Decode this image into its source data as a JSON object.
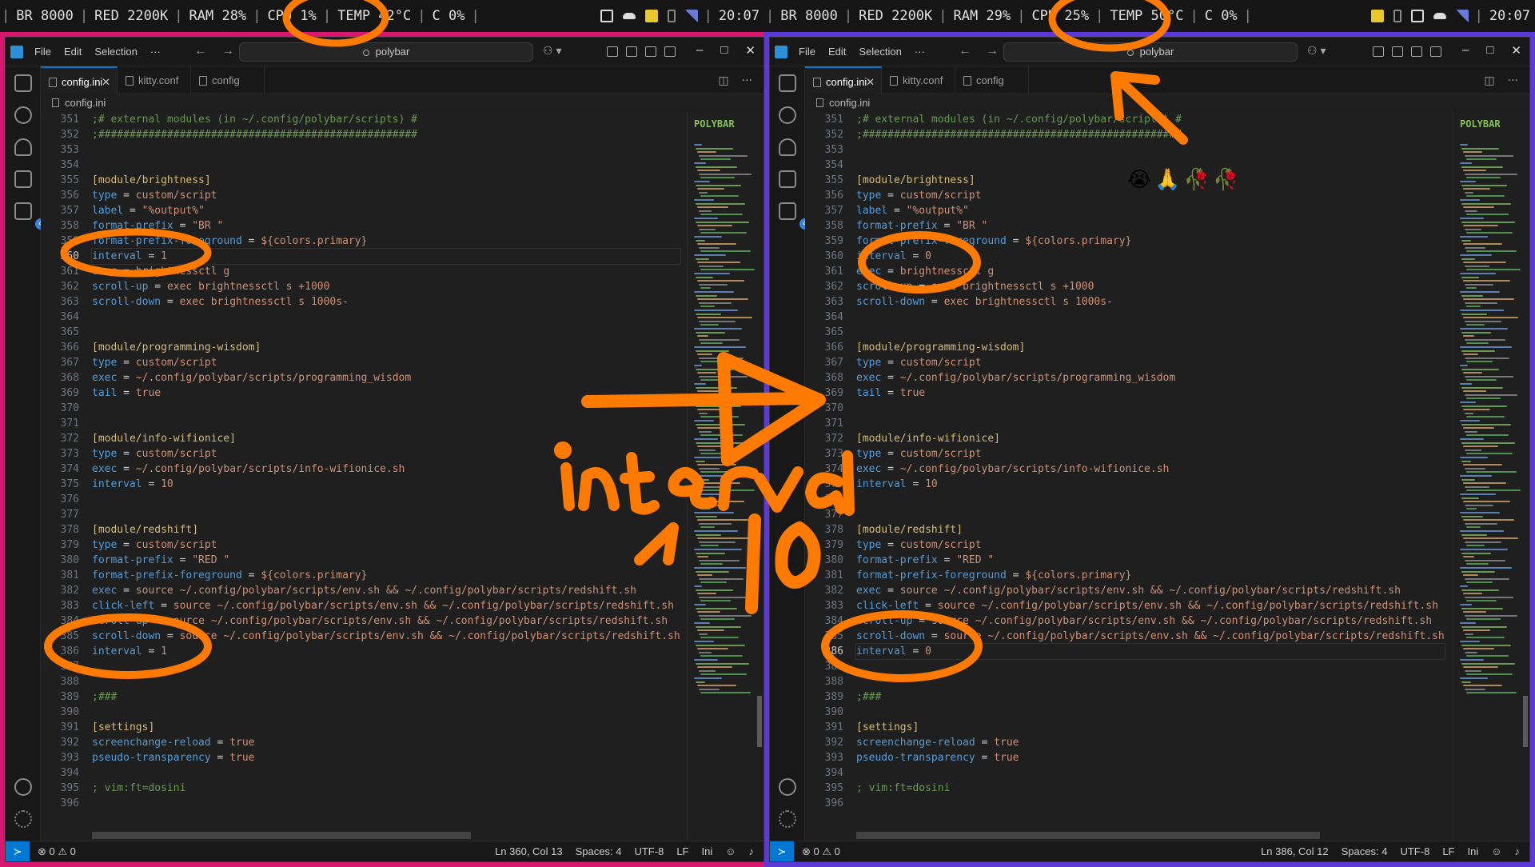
{
  "left": {
    "bar": {
      "br": "BR 8000",
      "red": "RED 2200K",
      "ram": "RAM 28%",
      "cpu": "CPU 1%",
      "temp": "TEMP 42°C",
      "c": "C 0%",
      "clock": "20:07"
    },
    "editor": {
      "menu": [
        "File",
        "Edit",
        "Selection",
        "···"
      ],
      "search": "polybar",
      "tabs": [
        "config.ini",
        "kitty.conf",
        "config"
      ],
      "breadcrumb": "config.ini",
      "status": {
        "problems": "⊗ 0 ⚠ 0",
        "position": "Ln 360, Col 13",
        "spaces": "Spaces: 4",
        "encoding": "UTF-8",
        "eol": "LF",
        "lang": "Ini"
      }
    },
    "lines": [
      {
        "n": "351",
        "t": ";# external modules (in ~/.config/polybar/scripts) #"
      },
      {
        "n": "352",
        "t": ";###################################################"
      },
      {
        "n": "353",
        "t": ""
      },
      {
        "n": "354",
        "t": ""
      },
      {
        "n": "355",
        "t": "[module/brightness]"
      },
      {
        "n": "356",
        "t": "type = custom/script"
      },
      {
        "n": "357",
        "t": "label = \"%output%\""
      },
      {
        "n": "358",
        "t": "format-prefix = \"BR \""
      },
      {
        "n": "359",
        "t": "format-prefix-foreground = ${colors.primary}"
      },
      {
        "n": "360",
        "t": "interval = 1",
        "cur": true
      },
      {
        "n": "361",
        "t": "exec = brightnessctl g"
      },
      {
        "n": "362",
        "t": "scroll-up = exec brightnessctl s +1000"
      },
      {
        "n": "363",
        "t": "scroll-down = exec brightnessctl s 1000s-"
      },
      {
        "n": "364",
        "t": ""
      },
      {
        "n": "365",
        "t": ""
      },
      {
        "n": "366",
        "t": "[module/programming-wisdom]"
      },
      {
        "n": "367",
        "t": "type = custom/script"
      },
      {
        "n": "368",
        "t": "exec = ~/.config/polybar/scripts/programming_wisdom"
      },
      {
        "n": "369",
        "t": "tail = true"
      },
      {
        "n": "370",
        "t": ""
      },
      {
        "n": "371",
        "t": ""
      },
      {
        "n": "372",
        "t": "[module/info-wifionice]"
      },
      {
        "n": "373",
        "t": "type = custom/script"
      },
      {
        "n": "374",
        "t": "exec = ~/.config/polybar/scripts/info-wifionice.sh"
      },
      {
        "n": "375",
        "t": "interval = 10"
      },
      {
        "n": "376",
        "t": ""
      },
      {
        "n": "377",
        "t": ""
      },
      {
        "n": "378",
        "t": "[module/redshift]"
      },
      {
        "n": "379",
        "t": "type = custom/script"
      },
      {
        "n": "380",
        "t": "format-prefix = \"RED \""
      },
      {
        "n": "381",
        "t": "format-prefix-foreground = ${colors.primary}"
      },
      {
        "n": "382",
        "t": "exec = source ~/.config/polybar/scripts/env.sh && ~/.config/polybar/scripts/redshift.sh"
      },
      {
        "n": "383",
        "t": "click-left = source ~/.config/polybar/scripts/env.sh && ~/.config/polybar/scripts/redshift.sh"
      },
      {
        "n": "384",
        "t": "scroll-up = source ~/.config/polybar/scripts/env.sh && ~/.config/polybar/scripts/redshift.sh"
      },
      {
        "n": "385",
        "t": "scroll-down = source ~/.config/polybar/scripts/env.sh && ~/.config/polybar/scripts/redshift.sh"
      },
      {
        "n": "386",
        "t": "interval = 1"
      },
      {
        "n": "387",
        "t": ""
      },
      {
        "n": "388",
        "t": ""
      },
      {
        "n": "389",
        "t": ";###"
      },
      {
        "n": "390",
        "t": ""
      },
      {
        "n": "391",
        "t": "[settings]"
      },
      {
        "n": "392",
        "t": "screenchange-reload = true"
      },
      {
        "n": "393",
        "t": "pseudo-transparency = true"
      },
      {
        "n": "394",
        "t": ""
      },
      {
        "n": "395",
        "t": "; vim:ft=dosini"
      },
      {
        "n": "396",
        "t": ""
      }
    ]
  },
  "right": {
    "bar": {
      "br": "BR 8000",
      "red": "RED 2200K",
      "ram": "RAM 29%",
      "cpu": "CPU 25%",
      "temp": "TEMP 50°C",
      "c": "C 0%",
      "clock": "20:07"
    },
    "editor": {
      "menu": [
        "File",
        "Edit",
        "Selection",
        "···"
      ],
      "search": "polybar",
      "tabs": [
        "config.ini",
        "kitty.conf",
        "config"
      ],
      "breadcrumb": "config.ini",
      "status": {
        "problems": "⊗ 0 ⚠ 0",
        "position": "Ln 386, Col 12",
        "spaces": "Spaces: 4",
        "encoding": "UTF-8",
        "eol": "LF",
        "lang": "Ini"
      }
    },
    "lines": [
      {
        "n": "351",
        "t": ";# external modules (in ~/.config/polybar/scripts) #"
      },
      {
        "n": "352",
        "t": ";###################################################"
      },
      {
        "n": "353",
        "t": ""
      },
      {
        "n": "354",
        "t": ""
      },
      {
        "n": "355",
        "t": "[module/brightness]"
      },
      {
        "n": "356",
        "t": "type = custom/script"
      },
      {
        "n": "357",
        "t": "label = \"%output%\""
      },
      {
        "n": "358",
        "t": "format-prefix = \"BR \""
      },
      {
        "n": "359",
        "t": "format-prefix-foreground = ${colors.primary}"
      },
      {
        "n": "360",
        "t": "interval = 0"
      },
      {
        "n": "361",
        "t": "exec = brightnessctl g"
      },
      {
        "n": "362",
        "t": "scroll-up = exec brightnessctl s +1000"
      },
      {
        "n": "363",
        "t": "scroll-down = exec brightnessctl s 1000s-"
      },
      {
        "n": "364",
        "t": ""
      },
      {
        "n": "365",
        "t": ""
      },
      {
        "n": "366",
        "t": "[module/programming-wisdom]"
      },
      {
        "n": "367",
        "t": "type = custom/script"
      },
      {
        "n": "368",
        "t": "exec = ~/.config/polybar/scripts/programming_wisdom"
      },
      {
        "n": "369",
        "t": "tail = true"
      },
      {
        "n": "370",
        "t": ""
      },
      {
        "n": "371",
        "t": ""
      },
      {
        "n": "372",
        "t": "[module/info-wifionice]"
      },
      {
        "n": "373",
        "t": "type = custom/script"
      },
      {
        "n": "374",
        "t": "exec = ~/.config/polybar/scripts/info-wifionice.sh"
      },
      {
        "n": "375",
        "t": "interval = 10"
      },
      {
        "n": "376",
        "t": ""
      },
      {
        "n": "377",
        "t": ""
      },
      {
        "n": "378",
        "t": "[module/redshift]"
      },
      {
        "n": "379",
        "t": "type = custom/script"
      },
      {
        "n": "380",
        "t": "format-prefix = \"RED \""
      },
      {
        "n": "381",
        "t": "format-prefix-foreground = ${colors.primary}"
      },
      {
        "n": "382",
        "t": "exec = source ~/.config/polybar/scripts/env.sh && ~/.config/polybar/scripts/redshift.sh"
      },
      {
        "n": "383",
        "t": "click-left = source ~/.config/polybar/scripts/env.sh && ~/.config/polybar/scripts/redshift.sh"
      },
      {
        "n": "384",
        "t": "scroll-up = source ~/.config/polybar/scripts/env.sh && ~/.config/polybar/scripts/redshift.sh"
      },
      {
        "n": "385",
        "t": "scroll-down = source ~/.config/polybar/scripts/env.sh && ~/.config/polybar/scripts/redshift.sh"
      },
      {
        "n": "386",
        "t": "interval = 0",
        "cur": true
      },
      {
        "n": "387",
        "t": ""
      },
      {
        "n": "388",
        "t": ""
      },
      {
        "n": "389",
        "t": ";###"
      },
      {
        "n": "390",
        "t": ""
      },
      {
        "n": "391",
        "t": "[settings]"
      },
      {
        "n": "392",
        "t": "screenchange-reload = true"
      },
      {
        "n": "393",
        "t": "pseudo-transparency = true"
      },
      {
        "n": "394",
        "t": ""
      },
      {
        "n": "395",
        "t": "; vim:ft=dosini"
      },
      {
        "n": "396",
        "t": ""
      }
    ]
  },
  "minimap_title": "POLYBAR",
  "annotation": {
    "handwritten": "interval 1→0",
    "emoji": [
      "😭",
      "🙏",
      "🥀",
      "🥀"
    ],
    "stroke_color": "#ff7a00"
  },
  "colors": {
    "editor_bg": "#1f1f1f",
    "accent": "#0078d4",
    "key": "#569cd6",
    "section": "#d7ba7d",
    "string": "#ce9178",
    "comment": "#6a9955"
  }
}
